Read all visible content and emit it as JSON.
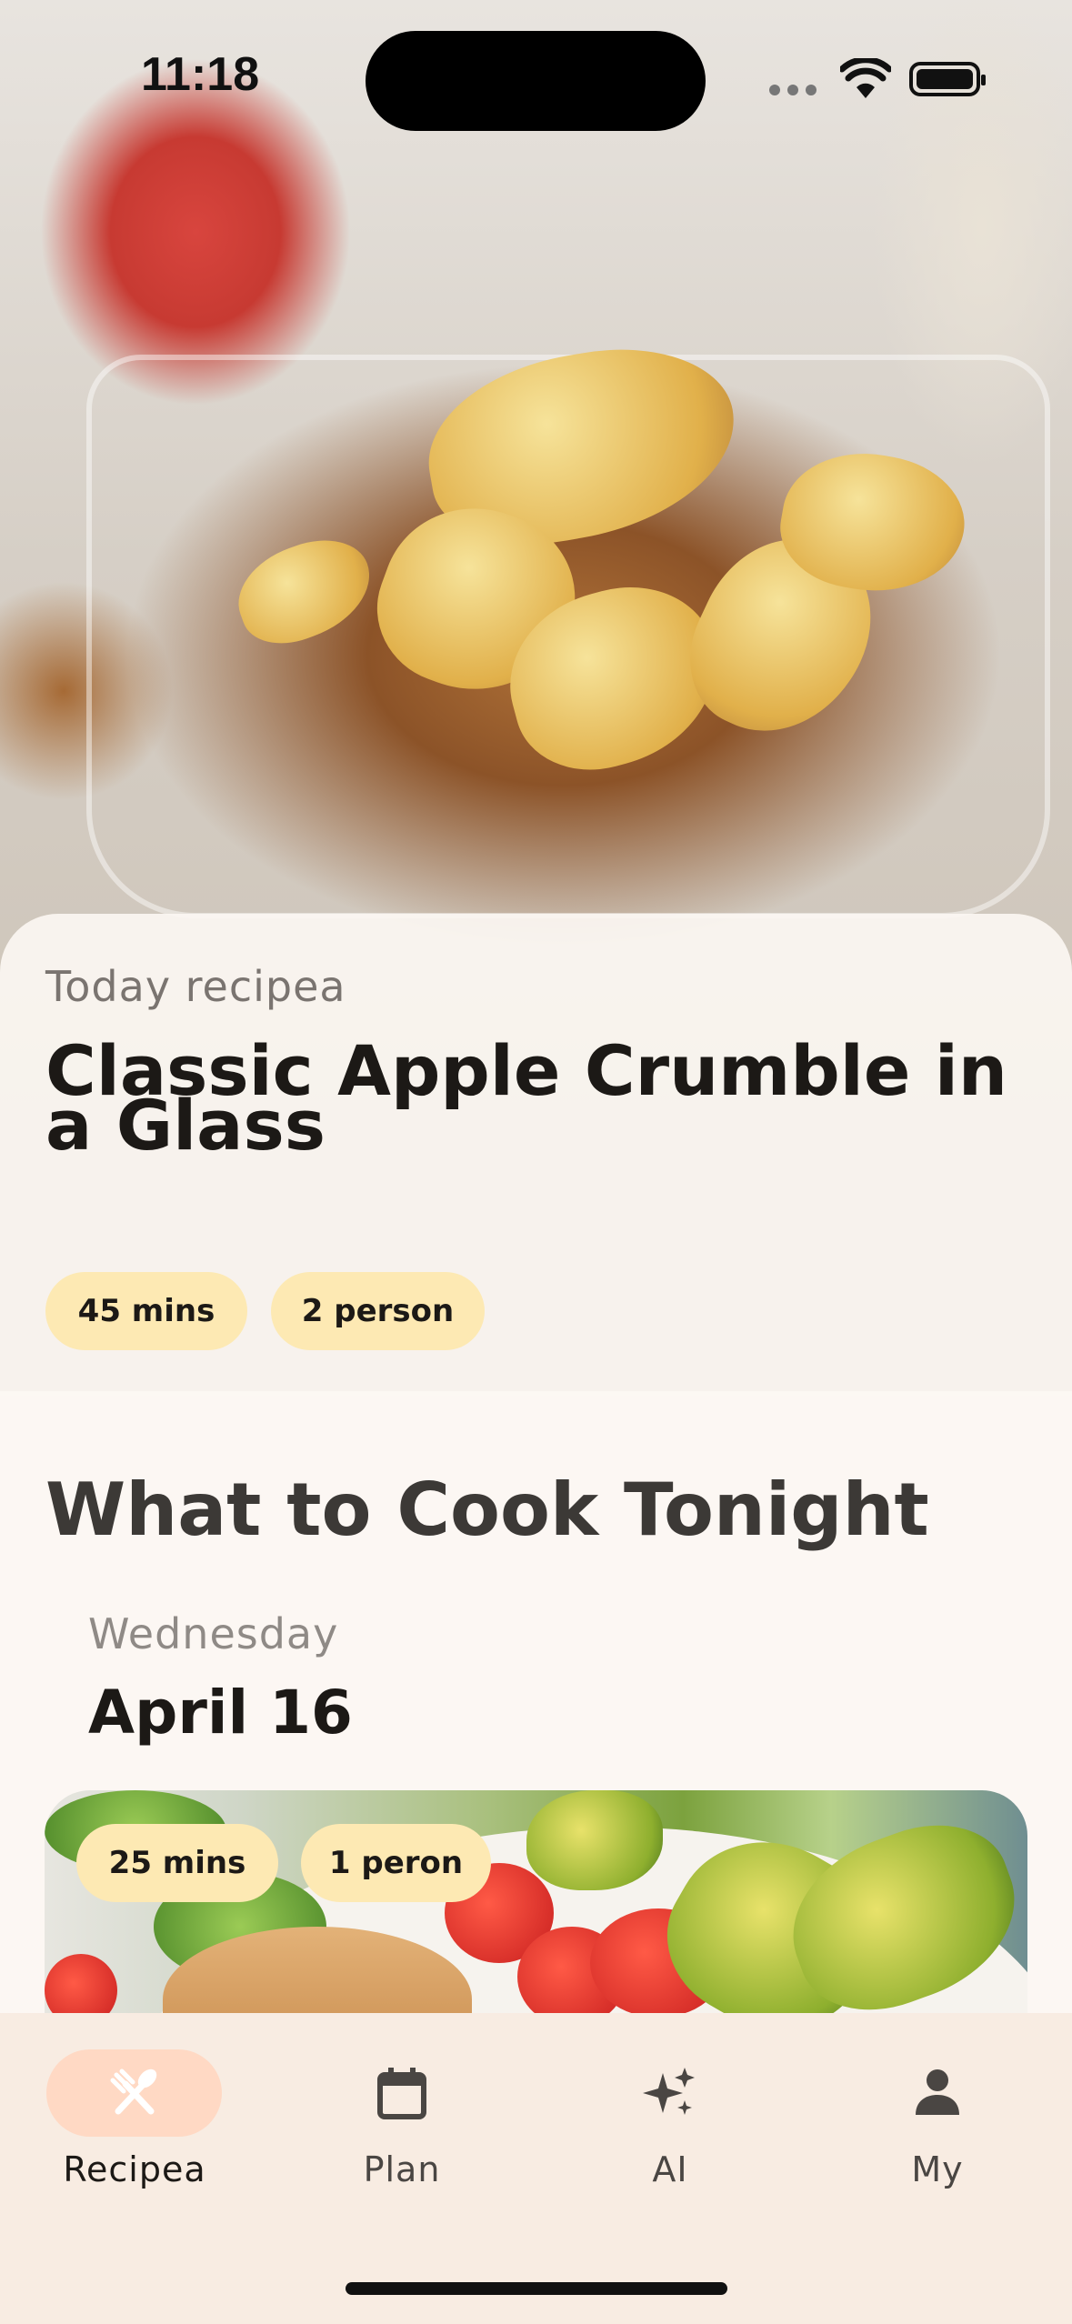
{
  "status_bar": {
    "time": "11:18"
  },
  "today": {
    "label": "Today recipea",
    "title": "Classic Apple Crumble in a Glass",
    "chips": [
      "45 mins",
      "2 person"
    ]
  },
  "tonight": {
    "heading": "What to Cook Tonight",
    "weekday": "Wednesday",
    "date": "April 16",
    "card_chips": [
      "25 mins",
      "1 peron"
    ]
  },
  "nav": {
    "items": [
      {
        "label": "Recipea",
        "icon": "fork-spoon-icon",
        "active": true
      },
      {
        "label": "Plan",
        "icon": "calendar-icon",
        "active": false
      },
      {
        "label": "AI",
        "icon": "sparkles-icon",
        "active": false
      },
      {
        "label": "My",
        "icon": "person-icon",
        "active": false
      }
    ]
  },
  "colors": {
    "background": "#FCF7F3",
    "chip": "#FDE9B3",
    "nav_background": "#F8ECE2",
    "nav_active_pill": "#FFD9C4",
    "text_primary": "#1C1916"
  }
}
